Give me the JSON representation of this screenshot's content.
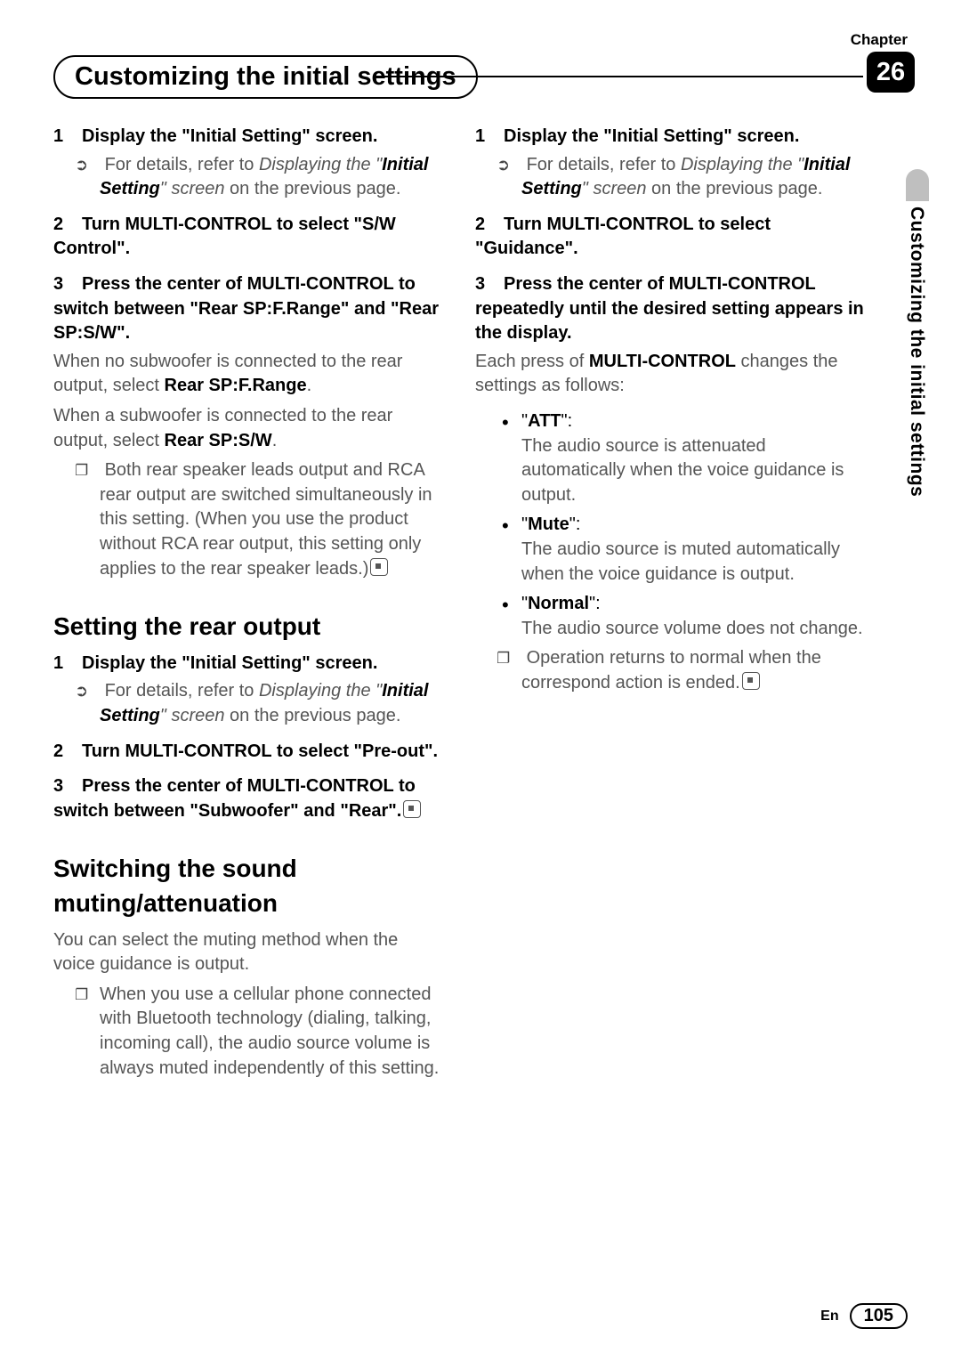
{
  "header": {
    "chapter_label": "Chapter",
    "title": "Customizing the initial settings",
    "chapter_num": "26"
  },
  "side_tab": "Customizing the initial settings",
  "left": {
    "s1": {
      "num": "1",
      "head": "Display the \"Initial Setting\" screen.",
      "sub_pre": "For details, refer to ",
      "sub_em": "Displaying the \"",
      "sub_b": "Initial Setting",
      "sub_em2": "\" screen",
      "sub_post": " on the previous page."
    },
    "s2": {
      "num": "2",
      "head": "Turn MULTI-CONTROL to select \"S/W Control\"."
    },
    "s3": {
      "num": "3",
      "head": "Press the center of MULTI-CONTROL to switch between \"Rear SP:F.Range\" and \"Rear SP:S/W\".",
      "p1_pre": "When no subwoofer is connected to the rear output, select ",
      "p1_b": "Rear SP:F.Range",
      "p1_post": ".",
      "p2_pre": "When a subwoofer is connected to the rear output, select ",
      "p2_b": "Rear SP:S/W",
      "p2_post": ".",
      "note": "Both rear speaker leads output and RCA rear output are switched simultaneously in this setting. (When you use the product without RCA rear output, this setting only applies to the rear speaker leads.)"
    },
    "h2a": "Setting the rear output",
    "s4": {
      "num": "1",
      "head": "Display the \"Initial Setting\" screen.",
      "sub_pre": "For details, refer to ",
      "sub_em": "Displaying the \"",
      "sub_b": "Initial Setting",
      "sub_em2": "\" screen",
      "sub_post": " on the previous page."
    },
    "s5": {
      "num": "2",
      "head": "Turn MULTI-CONTROL to select \"Pre-out\"."
    },
    "s6": {
      "num": "3",
      "head": "Press the center of MULTI-CONTROL to switch between \"Subwoofer\" and \"Rear\"."
    },
    "h2b": "Switching the sound muting/attenuation",
    "p_intro": "You can select the muting method when the voice guidance is output.",
    "p_note": "When you use a cellular phone connected with Bluetooth technology (dialing, talking, incoming call), the audio source volume is always muted independently of this setting."
  },
  "right": {
    "s1": {
      "num": "1",
      "head": "Display the \"Initial Setting\" screen.",
      "sub_pre": "For details, refer to ",
      "sub_em": "Displaying the \"",
      "sub_b": "Initial Setting",
      "sub_em2": "\" screen",
      "sub_post": " on the previous page."
    },
    "s2": {
      "num": "2",
      "head": "Turn MULTI-CONTROL to select \"Guidance\"."
    },
    "s3": {
      "num": "3",
      "head": "Press the center of MULTI-CONTROL repeatedly until the desired setting appears in the display.",
      "p_pre": "Each press of ",
      "p_b": "MULTI-CONTROL",
      "p_post": " changes the settings as follows:"
    },
    "opts": {
      "a_lab": "ATT",
      "a_txt": "The audio source is attenuated automatically when the voice guidance is output.",
      "b_lab": "Mute",
      "b_txt": "The audio source is muted automatically when the voice guidance is output.",
      "c_lab": "Normal",
      "c_txt": "The audio source volume does not change."
    },
    "end_note": "Operation returns to normal when the correspond action is ended."
  },
  "footer": {
    "lang": "En",
    "page": "105"
  }
}
